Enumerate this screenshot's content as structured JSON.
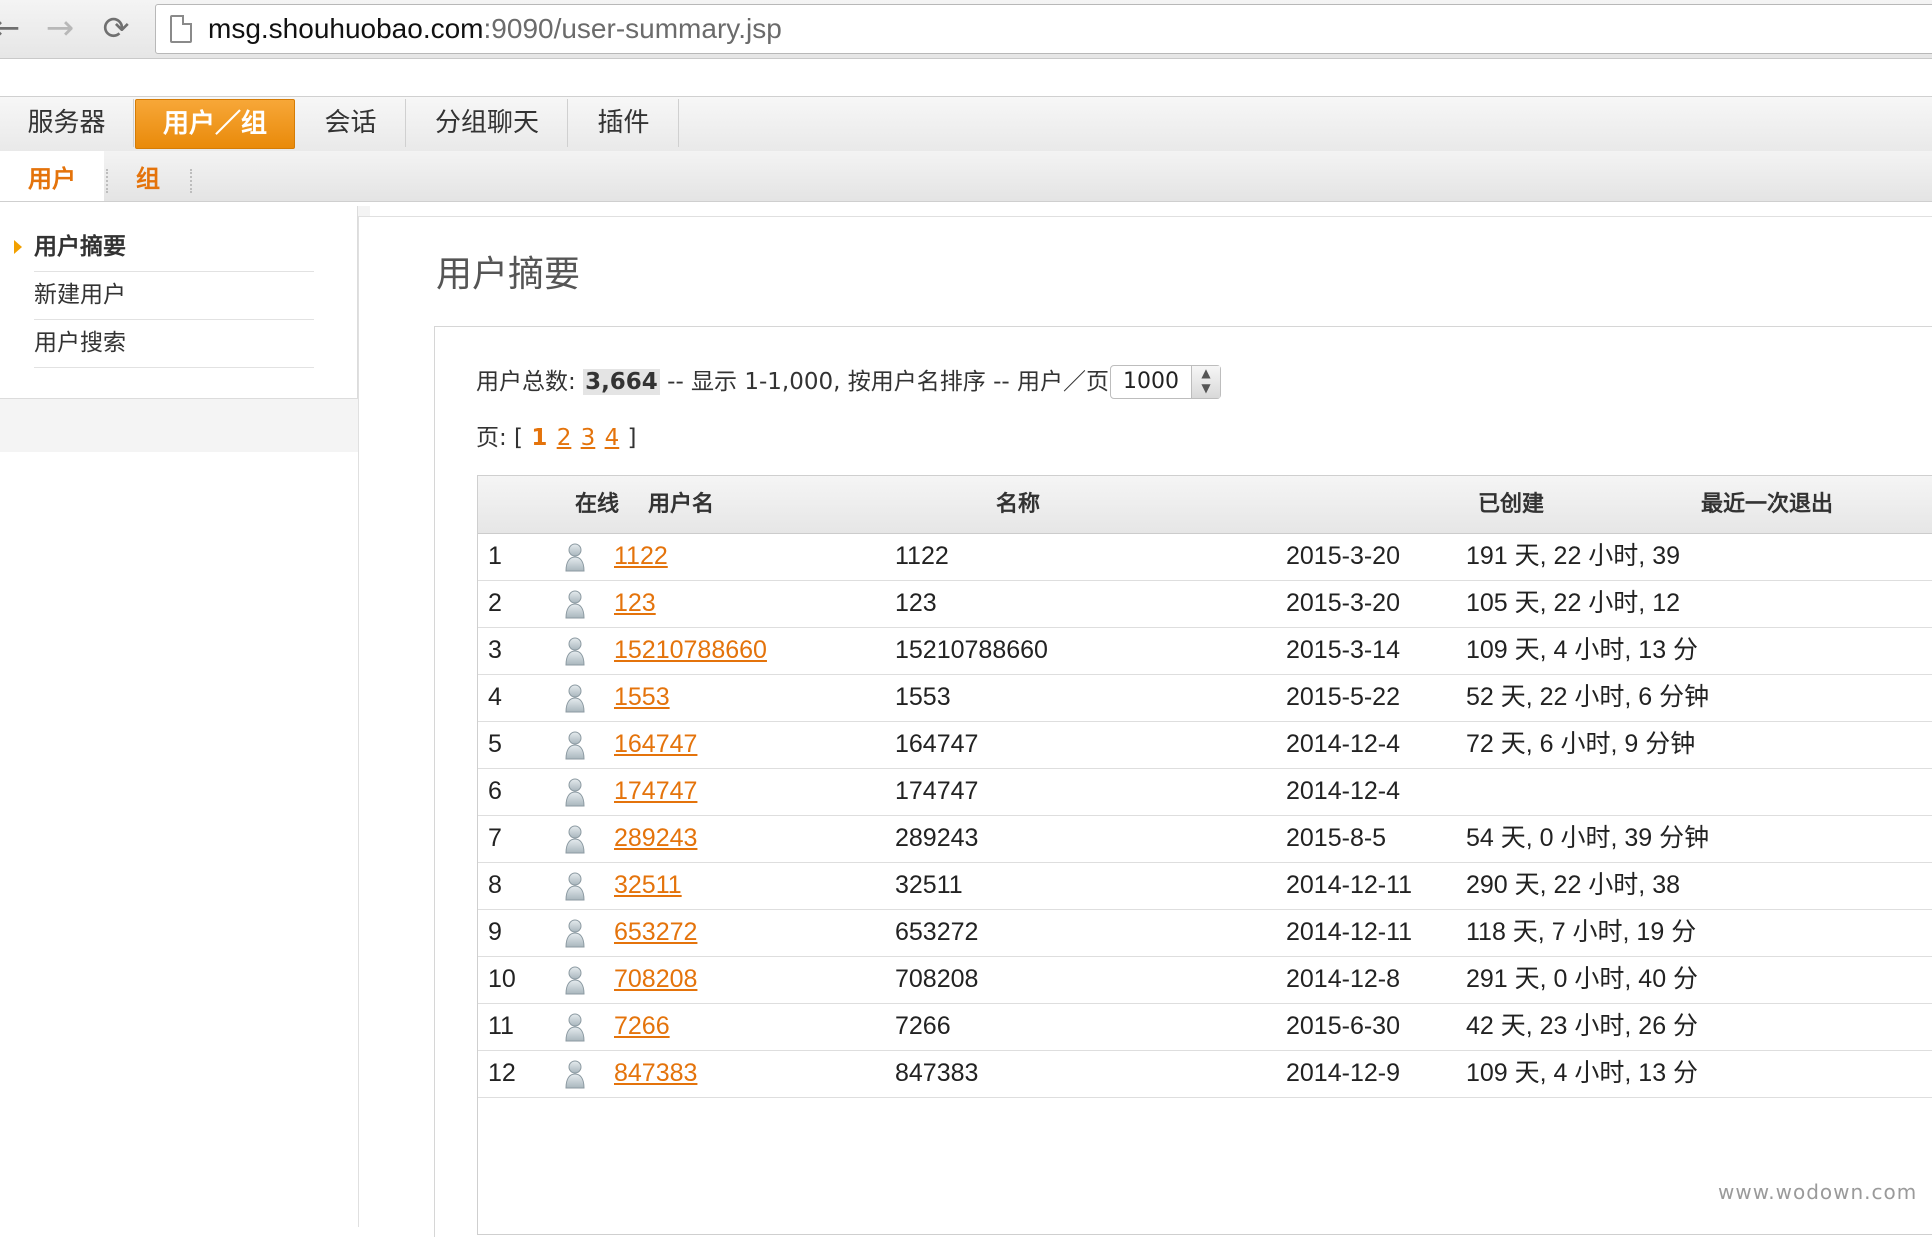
{
  "browser": {
    "url_host": "msg.shouhuobao.com",
    "url_rest": ":9090/user-summary.jsp"
  },
  "main_tabs": [
    "服务器",
    "用户／组",
    "会话",
    "分组聊天",
    "插件"
  ],
  "sub_tabs": [
    "用户",
    "组"
  ],
  "sidebar": {
    "items": [
      "用户摘要",
      "新建用户",
      "用户搜索"
    ]
  },
  "page": {
    "title": "用户摘要",
    "summary_prefix": "用户总数:",
    "total_users": "3,664",
    "summary_suffix": "-- 显示 1-1,000, 按用户名排序 -- 用户／页:",
    "per_page": "1000",
    "pager_label": "页: [",
    "pager_close": "]",
    "pages": [
      "1",
      "2",
      "3",
      "4"
    ],
    "current_page": "1"
  },
  "table": {
    "headers": [
      "在线",
      "用户名",
      "名称",
      "已创建",
      "最近一次退出"
    ],
    "rows": [
      {
        "n": "1",
        "username": "1122",
        "name": "1122",
        "created": "2015-3-20",
        "last": "191 天, 22 小时, 39"
      },
      {
        "n": "2",
        "username": "123",
        "name": "123",
        "created": "2015-3-20",
        "last": "105 天, 22 小时, 12"
      },
      {
        "n": "3",
        "username": "15210788660",
        "name": "15210788660",
        "created": "2015-3-14",
        "last": "109 天, 4 小时, 13 分"
      },
      {
        "n": "4",
        "username": "1553",
        "name": "1553",
        "created": "2015-5-22",
        "last": "52 天, 22 小时, 6 分钟"
      },
      {
        "n": "5",
        "username": "164747",
        "name": "164747",
        "created": "2014-12-4",
        "last": "72 天, 6 小时, 9 分钟"
      },
      {
        "n": "6",
        "username": "174747",
        "name": "174747",
        "created": "2014-12-4",
        "last": ""
      },
      {
        "n": "7",
        "username": "289243",
        "name": "289243",
        "created": "2015-8-5",
        "last": "54 天, 0 小时, 39 分钟"
      },
      {
        "n": "8",
        "username": "32511",
        "name": "32511",
        "created": "2014-12-11",
        "last": "290 天, 22 小时, 38"
      },
      {
        "n": "9",
        "username": "653272",
        "name": "653272",
        "created": "2014-12-11",
        "last": "118 天, 7 小时, 19 分"
      },
      {
        "n": "10",
        "username": "708208",
        "name": "708208",
        "created": "2014-12-8",
        "last": "291 天, 0 小时, 40 分"
      },
      {
        "n": "11",
        "username": "7266",
        "name": "7266",
        "created": "2015-6-30",
        "last": "42 天, 23 小时, 26 分"
      },
      {
        "n": "12",
        "username": "847383",
        "name": "847383",
        "created": "2014-12-9",
        "last": "109 天, 4 小时, 13 分"
      }
    ]
  },
  "watermark": "www.wodown.com",
  "colors": {
    "accent": "#e98a0a",
    "link": "#e4730b"
  }
}
